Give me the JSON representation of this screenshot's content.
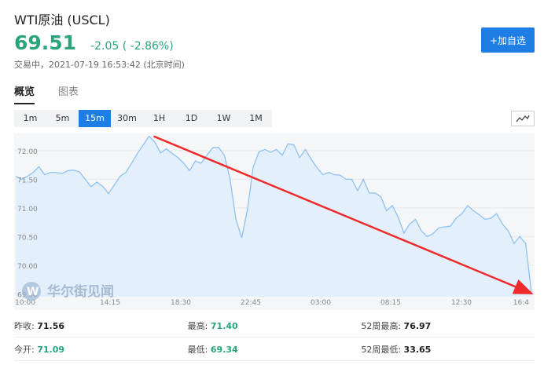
{
  "header": {
    "title": "WTI原油 (USCL)",
    "price": "69.51",
    "change": "-2.05 ( -2.86%)",
    "status": "交易中，2021-07-19 16:53:42 (北京时间)",
    "add_button": "+加自选"
  },
  "tabs": [
    "概览",
    "图表"
  ],
  "intervals": [
    "1m",
    "5m",
    "15m",
    "30m",
    "1H",
    "1D",
    "1W",
    "1M"
  ],
  "active_interval": "15m",
  "watermark": "华尔街见闻",
  "colors": {
    "green": "#2aa57a",
    "blue": "#1f7de6",
    "line": "#8fc1f0",
    "fill": "#e3f0fc",
    "arrow": "#ee2a2a"
  },
  "chart_data": {
    "type": "area",
    "y_ticks": [
      "72.00",
      "71.50",
      "71.00",
      "70.50",
      "70.00",
      "69.50"
    ],
    "x_ticks": [
      "10:00",
      "14:15",
      "18:30",
      "22:45",
      "03:00",
      "08:15",
      "12:30",
      "16:4"
    ],
    "ylim": [
      69.45,
      72.3
    ],
    "values": [
      71.55,
      71.5,
      71.55,
      71.62,
      71.72,
      71.58,
      71.62,
      71.62,
      71.6,
      71.65,
      71.66,
      71.63,
      71.5,
      71.37,
      71.45,
      71.38,
      71.25,
      71.4,
      71.55,
      71.62,
      71.78,
      71.95,
      72.1,
      72.25,
      72.15,
      71.96,
      72.03,
      71.95,
      71.88,
      71.78,
      71.65,
      71.82,
      71.78,
      71.92,
      72.05,
      72.06,
      71.92,
      71.5,
      70.8,
      70.48,
      70.98,
      71.72,
      71.98,
      72.02,
      71.97,
      72.02,
      71.92,
      72.12,
      72.1,
      71.88,
      72.02,
      71.85,
      71.7,
      71.58,
      71.62,
      71.58,
      71.57,
      71.5,
      71.5,
      71.3,
      71.5,
      71.26,
      71.26,
      71.2,
      70.95,
      71.04,
      70.84,
      70.56,
      70.72,
      70.8,
      70.6,
      70.5,
      70.55,
      70.65,
      70.67,
      70.68,
      70.82,
      70.9,
      71.04,
      70.95,
      70.88,
      70.8,
      70.82,
      70.9,
      70.72,
      70.6,
      70.38,
      70.5,
      70.38,
      69.52
    ],
    "annotation": "red trend arrow from peak near 72.25 down to latest value 69.51"
  },
  "stats": [
    [
      {
        "label": "昨收:",
        "value": "71.56",
        "green": false
      },
      {
        "label": "最高:",
        "value": "71.40",
        "green": true
      },
      {
        "label": "52周最高:",
        "value": "76.97",
        "green": false
      }
    ],
    [
      {
        "label": "今开:",
        "value": "71.09",
        "green": true
      },
      {
        "label": "最低:",
        "value": "69.34",
        "green": true
      },
      {
        "label": "52周最低:",
        "value": "33.65",
        "green": false
      }
    ]
  ]
}
